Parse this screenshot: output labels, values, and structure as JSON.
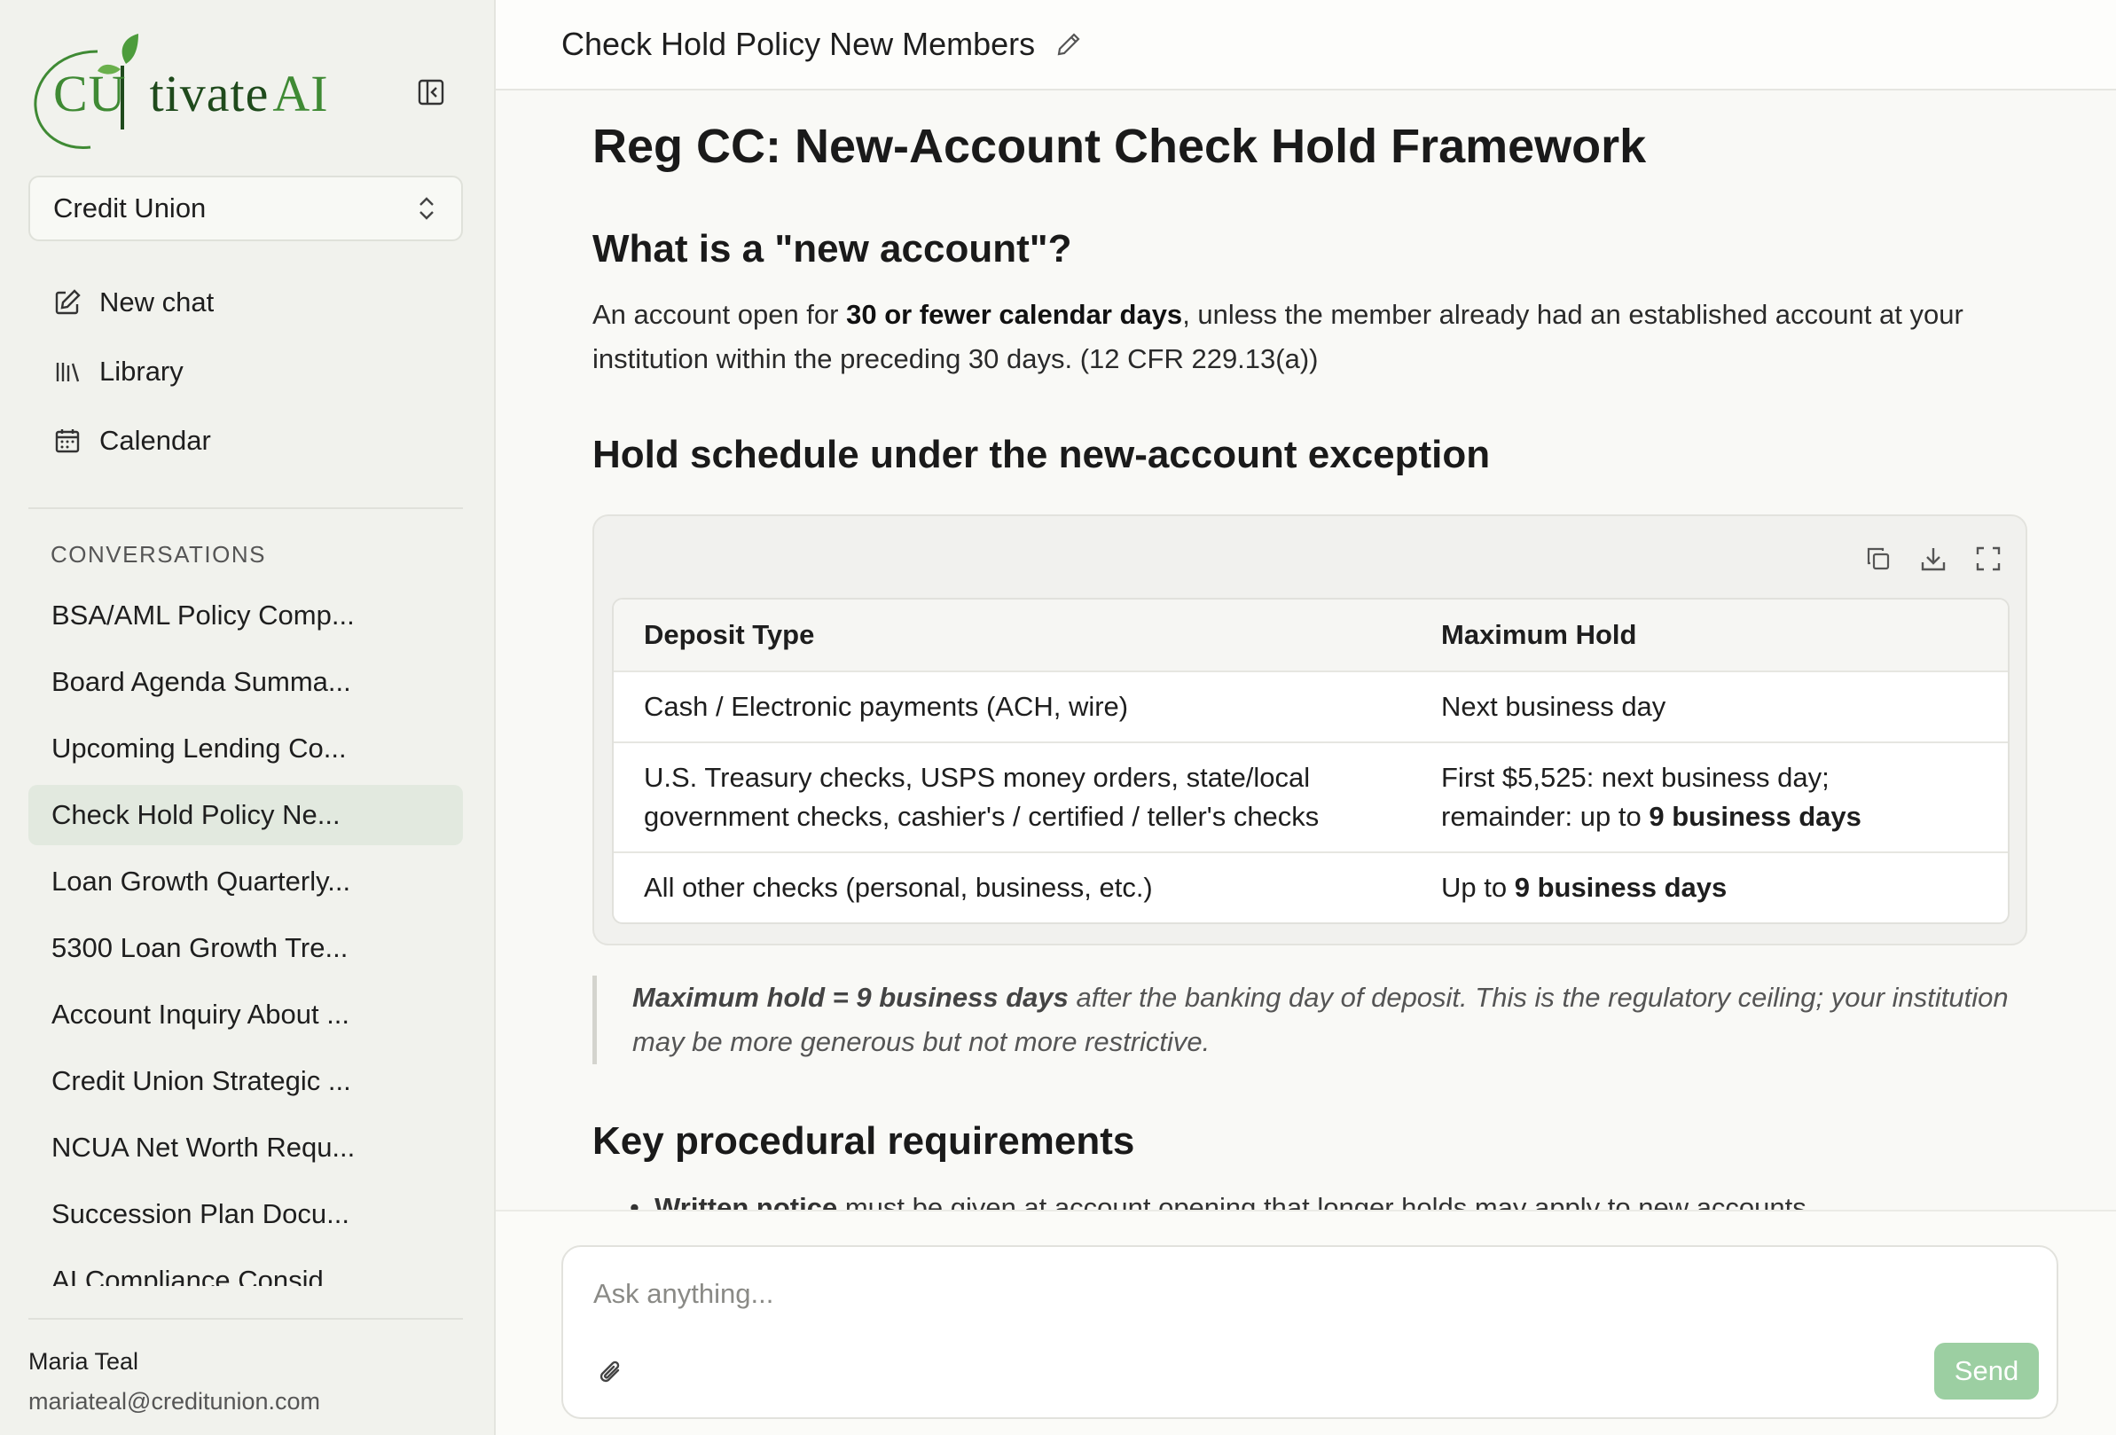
{
  "sidebar": {
    "logo": {
      "part1": "CU",
      "part2": "tivate",
      "part3": "AI"
    },
    "org_select": {
      "value": "Credit Union"
    },
    "nav": [
      {
        "label": "New chat",
        "icon": "new-chat-icon"
      },
      {
        "label": "Library",
        "icon": "library-icon"
      },
      {
        "label": "Calendar",
        "icon": "calendar-icon"
      }
    ],
    "conversations_heading": "CONVERSATIONS",
    "conversations": [
      "BSA/AML Policy Comp...",
      "Board Agenda Summa...",
      "Upcoming Lending Co...",
      "Check Hold Policy Ne...",
      "Loan Growth Quarterly...",
      "5300 Loan Growth Tre...",
      "Account Inquiry About ...",
      "Credit Union Strategic ...",
      "NCUA Net Worth Requ...",
      "Succession Plan Docu...",
      "AI Compliance Consid..."
    ],
    "active_conversation_index": 3,
    "user": {
      "name": "Maria Teal",
      "email": "mariateal@creditunion.com"
    }
  },
  "header": {
    "title": "Check Hold Policy New Members"
  },
  "doc": {
    "title": "Reg CC: New-Account Check Hold Framework",
    "section1": {
      "heading": "What is a \"new account\"?",
      "text_before": "An account open for ",
      "bold": "30 or fewer calendar days",
      "text_after": ", unless the member already had an established account at your institution within the preceding 30 days. (12 CFR 229.13(a))"
    },
    "section2": {
      "heading": "Hold schedule under the new-account exception"
    },
    "table": {
      "headers": [
        "Deposit Type",
        "Maximum Hold"
      ],
      "rows": [
        {
          "type": "Cash / Electronic payments (ACH, wire)",
          "hold_pre": "Next business day",
          "hold_bold": ""
        },
        {
          "type_line1": "U.S. Treasury checks, USPS money orders, state/local",
          "type_line2": "government checks, cashier's / certified / teller's checks",
          "hold_line1": "First $5,525: next business day;",
          "hold_line2_pre": "remainder: up to ",
          "hold_bold": "9 business days"
        },
        {
          "type": "All other checks (personal, business, etc.)",
          "hold_pre": "Up to ",
          "hold_bold": "9 business days"
        }
      ]
    },
    "note": {
      "bold": "Maximum hold = 9 business days",
      "text": " after the banking day of deposit. This is the regulatory ceiling; your institution may be more generous but not more restrictive."
    },
    "section3": {
      "heading": "Key procedural requirements"
    },
    "cut_text": {
      "bold": "Written notice",
      "text": " must be given at account opening that longer holds may apply to new accounts"
    }
  },
  "composer": {
    "placeholder": "Ask anything...",
    "send_label": "Send"
  },
  "colors": {
    "brand_green": "#3f8a34",
    "send_button": "#9ccfa2",
    "active_item": "#e2e9df"
  }
}
